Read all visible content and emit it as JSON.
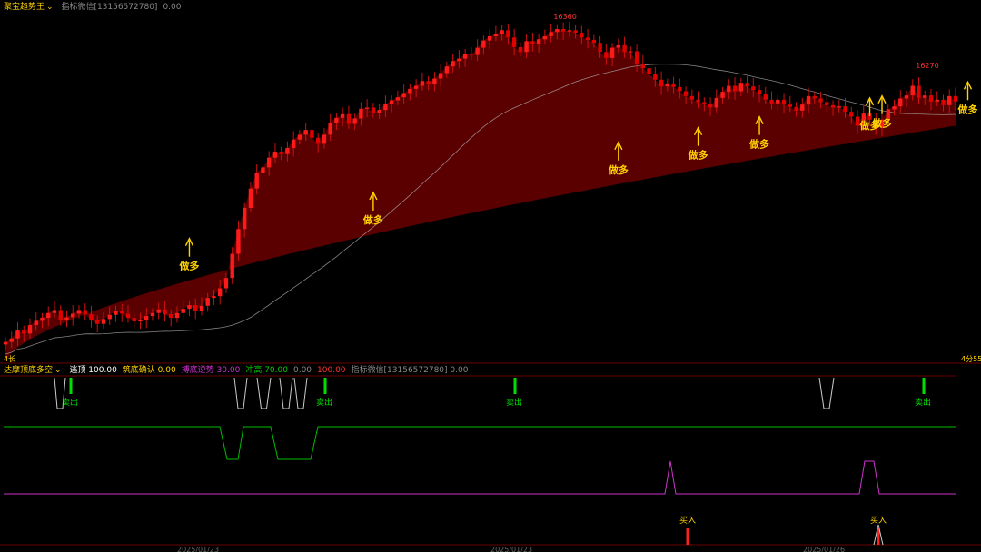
{
  "main_header": {
    "indicator_name": "聚宝趋势王",
    "dropdown_icon": "chevron-down-icon",
    "contact": "指标微信[13156572780]",
    "value": "0.00"
  },
  "sub_header": {
    "indicator_name": "达摩顶底多空",
    "items": [
      {
        "label": "逃顶",
        "value": "100.00",
        "color": "#ffffff"
      },
      {
        "label": "筑底确认",
        "value": "0.00",
        "color": "#ffd200"
      },
      {
        "label": "搏底逆势",
        "value": "30.00",
        "color": "#cc33cc"
      },
      {
        "label": "冲高",
        "value": "70.00",
        "color": "#00cc00"
      },
      {
        "label": "",
        "value": "0.00",
        "color": "#888888"
      },
      {
        "label": "",
        "value": "100.00",
        "color": "#ff3030"
      },
      {
        "label": "指标微信[13156572780]",
        "value": "0.00",
        "color": "#888888"
      }
    ]
  },
  "left_axis_label": "4长",
  "right_axis_label": "4分55",
  "dates": [
    "2025/01/23",
    "2025/01/23",
    "2025/01/26"
  ],
  "chart_data": [
    {
      "type": "candlestick",
      "title": "聚宝趋势王",
      "y_range": [
        15800,
        16380
      ],
      "annotations": {
        "high": {
          "value": 16360,
          "label": "16360"
        },
        "recent_high": {
          "value": 16270,
          "label": "16270"
        },
        "signal_text": "做多",
        "signal_index": [
          30,
          60,
          100,
          113,
          123,
          141,
          143,
          157,
          161
        ]
      },
      "close": [
        15832,
        15838,
        15851,
        15846,
        15860,
        15867,
        15872,
        15880,
        15885,
        15869,
        15873,
        15879,
        15885,
        15878,
        15868,
        15862,
        15870,
        15877,
        15884,
        15879,
        15872,
        15866,
        15869,
        15875,
        15880,
        15886,
        15878,
        15872,
        15880,
        15887,
        15893,
        15884,
        15892,
        15905,
        15908,
        15921,
        15938,
        15978,
        16019,
        16054,
        16086,
        16112,
        16121,
        16137,
        16147,
        16143,
        16153,
        16167,
        16175,
        16183,
        16170,
        16160,
        16175,
        16195,
        16203,
        16209,
        16193,
        16202,
        16218,
        16220,
        16211,
        16216,
        16226,
        16232,
        16237,
        16244,
        16251,
        16256,
        16264,
        16259,
        16268,
        16277,
        16288,
        16297,
        16301,
        16309,
        16307,
        16319,
        16331,
        16338,
        16341,
        16348,
        16336,
        16320,
        16312,
        16330,
        16325,
        16333,
        16338,
        16345,
        16350,
        16346,
        16348,
        16344,
        16336,
        16332,
        16327,
        16312,
        16302,
        16319,
        16323,
        16312,
        16313,
        16293,
        16285,
        16276,
        16266,
        16255,
        16260,
        16254,
        16247,
        16239,
        16233,
        16229,
        16226,
        16220,
        16236,
        16246,
        16256,
        16247,
        16261,
        16255,
        16249,
        16243,
        16233,
        16227,
        16233,
        16225,
        16221,
        16215,
        16225,
        16239,
        16235,
        16229,
        16224,
        16220,
        16222,
        16213,
        16205,
        16190,
        16210,
        16200,
        16187,
        16200,
        16217,
        16222,
        16235,
        16240,
        16256,
        16236,
        16240,
        16230,
        16233,
        16224,
        16239,
        16230
      ],
      "open_close_high_low": "derived",
      "ma_slow_label": "",
      "band_bottom_start": 15800,
      "band_bottom_end": 16190
    },
    {
      "type": "line",
      "title": "达摩顶底多空",
      "series": [
        {
          "name": "逃顶",
          "color": "#ffffff",
          "values_note": "spikes"
        },
        {
          "name": "冲高",
          "color": "#00cc00"
        },
        {
          "name": "搏底逆势",
          "color": "#cc33cc"
        }
      ],
      "sell_text": "卖出",
      "buy_text": "买入"
    }
  ]
}
